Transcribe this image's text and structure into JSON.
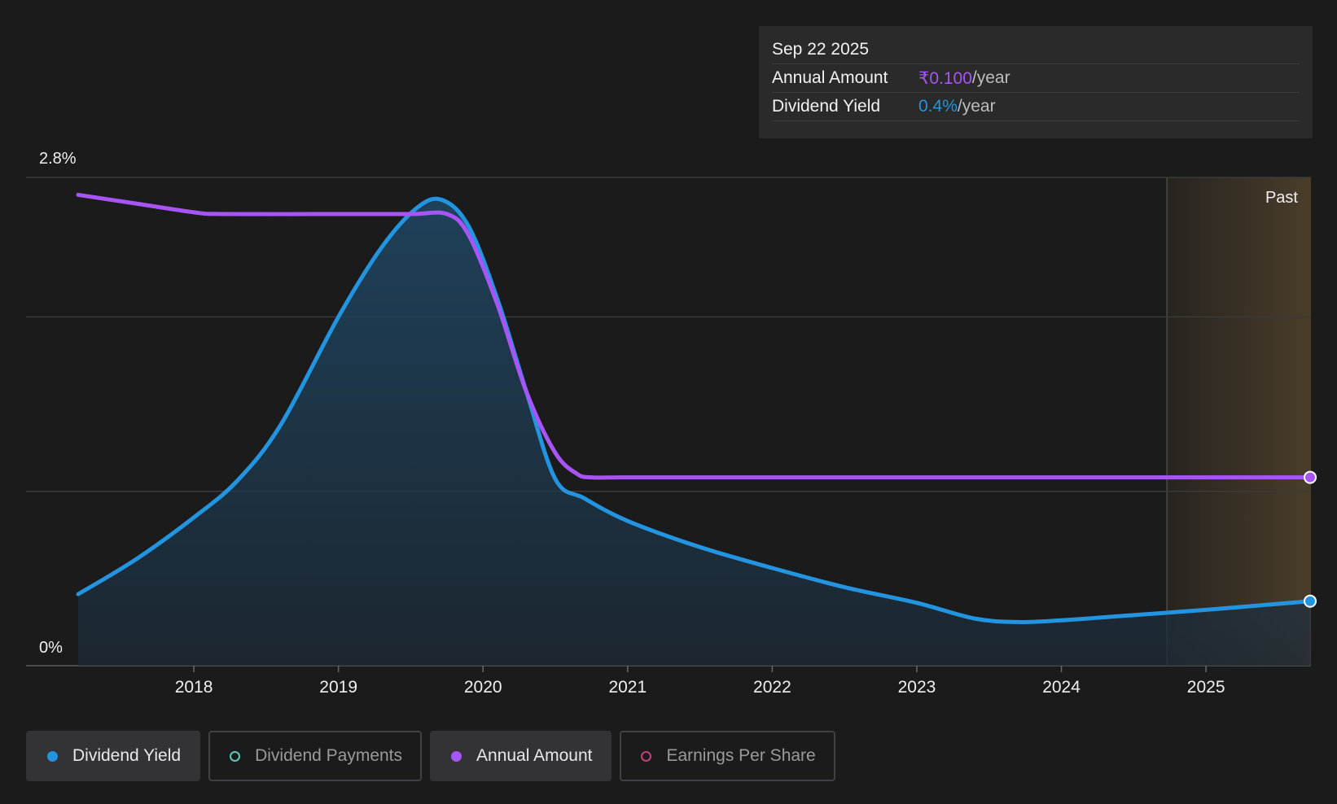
{
  "tooltip": {
    "date": "Sep 22 2025",
    "annual_label": "Annual Amount",
    "annual_value": "₹0.100",
    "annual_unit": "/year",
    "yield_label": "Dividend Yield",
    "yield_value": "0.4%",
    "yield_unit": "/year"
  },
  "colors": {
    "background": "#1b1b1c",
    "dividend_yield": "#2394e0",
    "annual_amount": "#a855f7",
    "dividend_payments": "#5ec8b8",
    "earnings_per_share": "#c2407e",
    "past_region": "#4a3d2a"
  },
  "legend": [
    {
      "label": "Dividend Yield",
      "active": true,
      "color": "#2394e0"
    },
    {
      "label": "Dividend Payments",
      "active": false,
      "color": "#5ec8b8"
    },
    {
      "label": "Annual Amount",
      "active": true,
      "color": "#a855f7"
    },
    {
      "label": "Earnings Per Share",
      "active": false,
      "color": "#c2407e"
    }
  ],
  "chart_data": {
    "type": "line",
    "xlim": [
      2017.2,
      2025.72
    ],
    "ylim": [
      0,
      2.8
    ],
    "y_tick_labels": [
      "2.8%",
      "0%"
    ],
    "x_ticks": [
      2018,
      2019,
      2020,
      2021,
      2022,
      2023,
      2024,
      2025
    ],
    "x_tick_labels": [
      "2018",
      "2019",
      "2020",
      "2021",
      "2022",
      "2023",
      "2024",
      "2025"
    ],
    "grid": true,
    "past_region": {
      "label": "Past",
      "start": 2024.73,
      "end": 2025.72
    },
    "series": [
      {
        "name": "Dividend Yield",
        "area": true,
        "x": [
          2017.2,
          2017.6,
          2018.0,
          2018.3,
          2018.6,
          2019.0,
          2019.3,
          2019.55,
          2019.72,
          2019.9,
          2020.1,
          2020.3,
          2020.5,
          2020.7,
          2021.0,
          2021.5,
          2022.0,
          2022.5,
          2023.0,
          2023.4,
          2023.7,
          2024.0,
          2024.5,
          2025.0,
          2025.72
        ],
        "values": [
          0.41,
          0.61,
          0.85,
          1.06,
          1.38,
          2.0,
          2.4,
          2.63,
          2.67,
          2.52,
          2.1,
          1.57,
          1.07,
          0.96,
          0.83,
          0.68,
          0.56,
          0.45,
          0.36,
          0.27,
          0.25,
          0.26,
          0.29,
          0.32,
          0.37
        ]
      },
      {
        "name": "Annual Amount",
        "area": false,
        "x": [
          2017.2,
          2017.6,
          2018.0,
          2018.2,
          2019.0,
          2019.5,
          2019.75,
          2019.9,
          2020.1,
          2020.3,
          2020.5,
          2020.65,
          2020.75,
          2021.0,
          2022.0,
          2023.0,
          2024.0,
          2025.0,
          2025.72
        ],
        "values": [
          2.7,
          2.65,
          2.6,
          2.59,
          2.59,
          2.59,
          2.59,
          2.47,
          2.07,
          1.57,
          1.22,
          1.1,
          1.08,
          1.08,
          1.08,
          1.08,
          1.08,
          1.08,
          1.08
        ]
      }
    ]
  }
}
